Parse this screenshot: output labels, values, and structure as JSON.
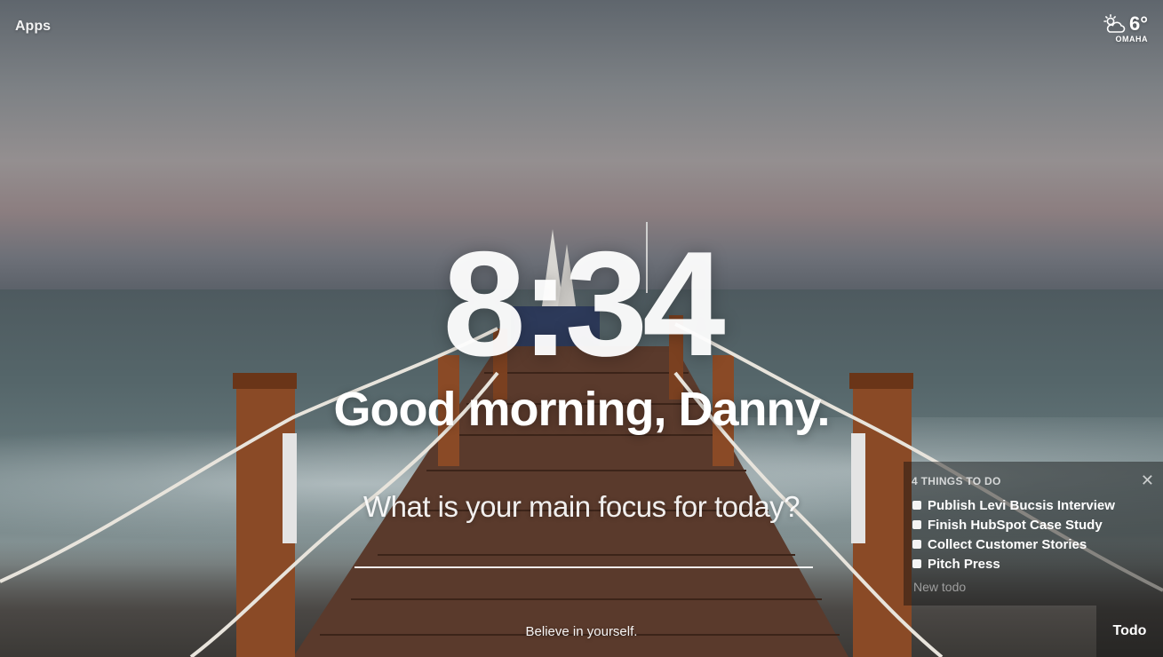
{
  "header": {
    "apps_label": "Apps",
    "weather": {
      "icon": "partly-cloudy-icon",
      "temperature": "6°",
      "location": "OMAHA"
    }
  },
  "center": {
    "time": "8:34",
    "greeting": "Good morning, Danny.",
    "focus_question": "What is your main focus for today?",
    "focus_input_value": ""
  },
  "footer": {
    "quote": "Believe in yourself."
  },
  "todo": {
    "heading": "4 THINGS TO DO",
    "close_icon": "close-icon",
    "items": [
      {
        "label": "Publish Levi Bucsis Interview",
        "done": false
      },
      {
        "label": "Finish HubSpot Case Study",
        "done": false
      },
      {
        "label": "Collect Customer Stories",
        "done": false
      },
      {
        "label": "Pitch Press",
        "done": false
      }
    ],
    "new_placeholder": "New todo",
    "tab_label": "Todo"
  }
}
